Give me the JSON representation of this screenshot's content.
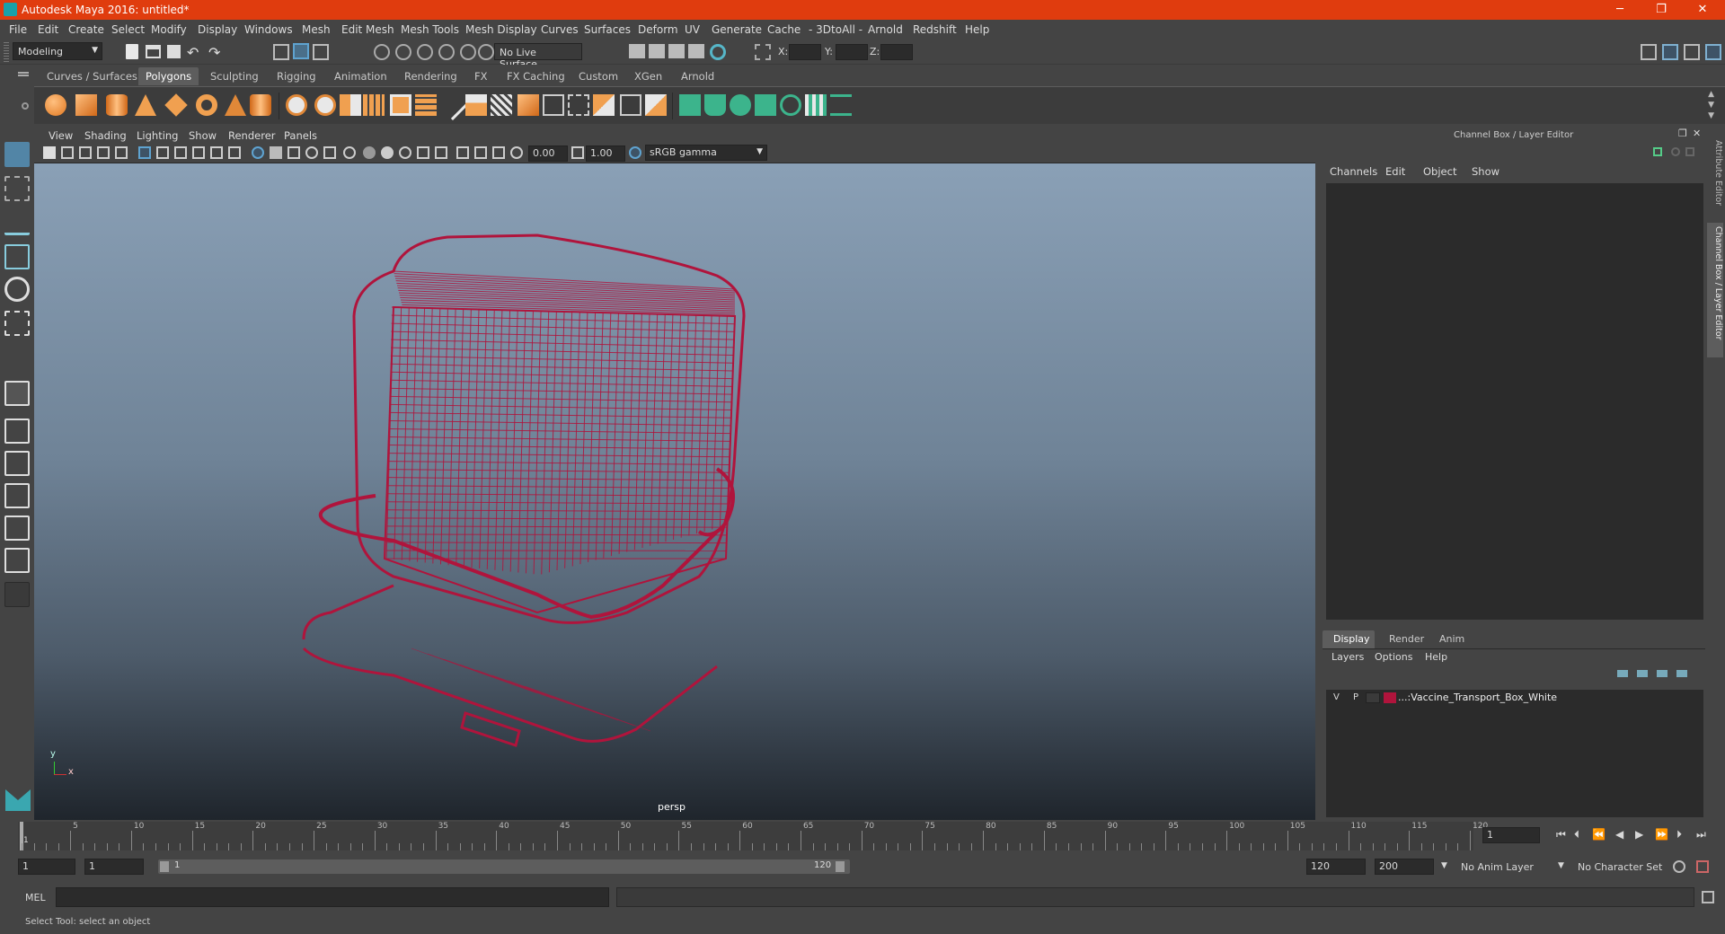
{
  "window": {
    "title": "Autodesk Maya 2016: untitled*",
    "min": "─",
    "max": "❐",
    "close": "✕"
  },
  "menus": [
    "File",
    "Edit",
    "Create",
    "Select",
    "Modify",
    "Display",
    "Windows",
    "Mesh",
    "Edit Mesh",
    "Mesh Tools",
    "Mesh Display",
    "Curves",
    "Surfaces",
    "Deform",
    "UV",
    "Generate",
    "Cache",
    "- 3DtoAll -",
    "Arnold",
    "Redshift",
    "Help"
  ],
  "statusline": {
    "mode": "Modeling",
    "live_surface": "No Live Surface",
    "x_label": "X:",
    "y_label": "Y:",
    "z_label": "Z:"
  },
  "shelf_tabs": [
    "Curves / Surfaces",
    "Polygons",
    "Sculpting",
    "Rigging",
    "Animation",
    "Rendering",
    "FX",
    "FX Caching",
    "Custom",
    "XGen",
    "Arnold"
  ],
  "shelf_active": "Polygons",
  "panel_menu": [
    "View",
    "Shading",
    "Lighting",
    "Show",
    "Renderer",
    "Panels"
  ],
  "panel_toolbar": {
    "exposure": "0.00",
    "gamma": "1.00",
    "colorspace": "sRGB gamma"
  },
  "viewport": {
    "camera": "persp",
    "axis_y": "y",
    "axis_x": "x"
  },
  "channel_box": {
    "title": "Channel Box / Layer Editor",
    "menus": [
      "Channels",
      "Edit",
      "Object",
      "Show"
    ]
  },
  "layer_editor": {
    "tabs": [
      "Display",
      "Render",
      "Anim"
    ],
    "active_tab": "Display",
    "menus": [
      "Layers",
      "Options",
      "Help"
    ],
    "layers": [
      {
        "v": "V",
        "p": "P",
        "color": "#b0143c",
        "name": "...:Vaccine_Transport_Box_White"
      }
    ]
  },
  "side_tabs": [
    "Attribute Editor",
    "Channel Box / Layer Editor"
  ],
  "timeline": {
    "ticks": [
      "5",
      "10",
      "15",
      "20",
      "25",
      "30",
      "35",
      "40",
      "45",
      "50",
      "55",
      "60",
      "65",
      "70",
      "75",
      "80",
      "85",
      "90",
      "95",
      "100",
      "105",
      "110",
      "115",
      "120"
    ],
    "first": "1",
    "current_frame": "1"
  },
  "range": {
    "start": "1",
    "start_inner": "1",
    "slider_start": "1",
    "slider_end": "120",
    "end_inner": "120",
    "end": "200",
    "anim_layer": "No Anim Layer",
    "char_set": "No Character Set"
  },
  "cmdline": {
    "label": "MEL"
  },
  "helpline": {
    "text": "Select Tool: select an object"
  },
  "colors": {
    "title_bar": "#e03c0e",
    "wireframe": "#b0143c",
    "accent": "#5285a6"
  }
}
